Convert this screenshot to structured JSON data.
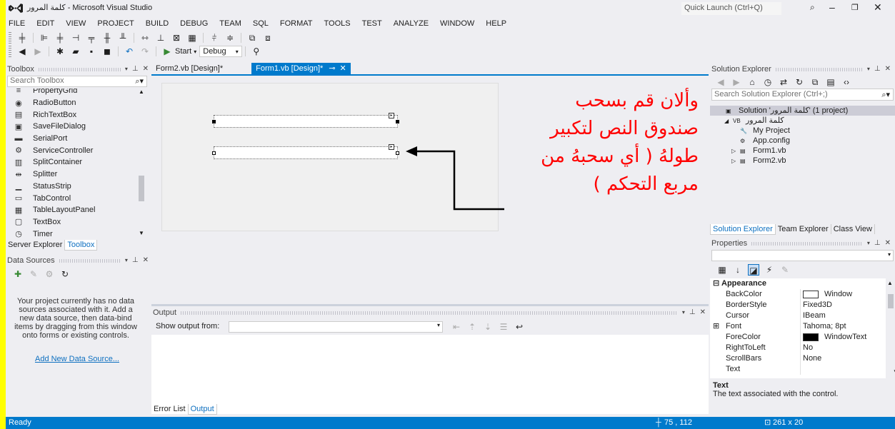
{
  "window": {
    "title": "كلمة المرور - Microsoft Visual Studio",
    "quick_launch_placeholder": "Quick Launch (Ctrl+Q)"
  },
  "menu": [
    "FILE",
    "EDIT",
    "VIEW",
    "PROJECT",
    "BUILD",
    "DEBUG",
    "TEAM",
    "SQL",
    "FORMAT",
    "TOOLS",
    "TEST",
    "ANALYZE",
    "WINDOW",
    "HELP"
  ],
  "toolbar": {
    "start_label": "Start",
    "config_value": "Debug"
  },
  "toolbox": {
    "title": "Toolbox",
    "search_placeholder": "Search Toolbox",
    "items": [
      {
        "label": "PropertyGrid",
        "icon": "≡"
      },
      {
        "label": "RadioButton",
        "icon": "◉"
      },
      {
        "label": "RichTextBox",
        "icon": "▤"
      },
      {
        "label": "SaveFileDialog",
        "icon": "▣"
      },
      {
        "label": "SerialPort",
        "icon": "▬"
      },
      {
        "label": "ServiceController",
        "icon": "⚙"
      },
      {
        "label": "SplitContainer",
        "icon": "▥"
      },
      {
        "label": "Splitter",
        "icon": "⇹"
      },
      {
        "label": "StatusStrip",
        "icon": "▁"
      },
      {
        "label": "TabControl",
        "icon": "▭"
      },
      {
        "label": "TableLayoutPanel",
        "icon": "▦"
      },
      {
        "label": "TextBox",
        "icon": "▢"
      },
      {
        "label": "Timer",
        "icon": "◷"
      }
    ],
    "tabs": [
      "Server Explorer",
      "Toolbox"
    ]
  },
  "data_sources": {
    "title": "Data Sources",
    "message": "Your project currently has no data sources associated with it. Add a new data source, then data-bind items by dragging from this window onto forms or existing controls.",
    "link": "Add New Data Source..."
  },
  "documents": {
    "tabs": [
      {
        "label": "Form2.vb [Design]*",
        "active": false
      },
      {
        "label": "Form1.vb [Design]*",
        "active": true
      }
    ]
  },
  "annotation": {
    "lines": [
      "وألان قم بسحب",
      "صندوق النص لتكبير",
      "طولهُ ( أي سحبهُ من",
      "مربع التحكم )"
    ]
  },
  "output": {
    "title": "Output",
    "show_from_label": "Show output from:",
    "tabs": [
      "Error List",
      "Output"
    ]
  },
  "solution_explorer": {
    "title": "Solution Explorer",
    "search_placeholder": "Search Solution Explorer (Ctrl+;)",
    "tree": [
      {
        "label": "Solution 'كلمة المرور' (1 project)",
        "indent": 0,
        "icon": "▣",
        "expander": "",
        "selected": true
      },
      {
        "label": "كلمة المرور",
        "indent": 1,
        "icon": "VB",
        "expander": "◢",
        "selected": false
      },
      {
        "label": "My Project",
        "indent": 2,
        "icon": "🔧",
        "expander": "",
        "selected": false
      },
      {
        "label": "App.config",
        "indent": 2,
        "icon": "⚙",
        "expander": "",
        "selected": false
      },
      {
        "label": "Form1.vb",
        "indent": 2,
        "icon": "▤",
        "expander": "▷",
        "selected": false
      },
      {
        "label": "Form2.vb",
        "indent": 2,
        "icon": "▤",
        "expander": "▷",
        "selected": false
      }
    ],
    "tabs": [
      "Solution Explorer",
      "Team Explorer",
      "Class View"
    ]
  },
  "properties": {
    "title": "Properties",
    "category": "Appearance",
    "rows": [
      {
        "name": "BackColor",
        "value": "Window",
        "swatch": "#ffffff"
      },
      {
        "name": "BorderStyle",
        "value": "Fixed3D",
        "swatch": ""
      },
      {
        "name": "Cursor",
        "value": "IBeam",
        "swatch": ""
      },
      {
        "name": "Font",
        "value": "Tahoma; 8pt",
        "swatch": "",
        "expander": "⊞"
      },
      {
        "name": "ForeColor",
        "value": "WindowText",
        "swatch": "#000000"
      },
      {
        "name": "RightToLeft",
        "value": "No",
        "swatch": ""
      },
      {
        "name": "ScrollBars",
        "value": "None",
        "swatch": ""
      },
      {
        "name": "Text",
        "value": "",
        "swatch": ""
      }
    ],
    "desc_title": "Text",
    "desc_text": "The text associated with the control."
  },
  "status": {
    "ready": "Ready",
    "position": "75 , 112",
    "size": "261 x 20"
  }
}
